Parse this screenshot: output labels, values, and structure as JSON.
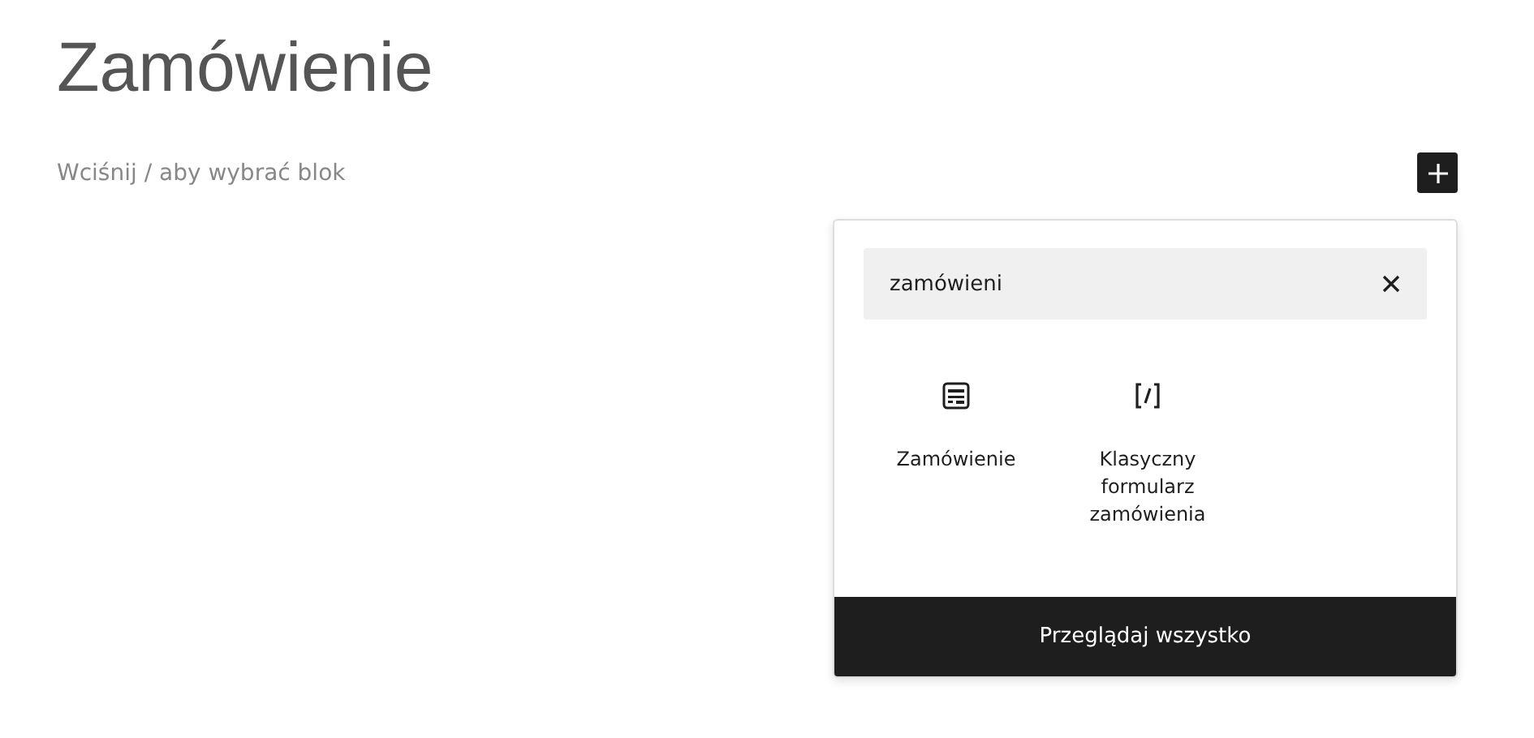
{
  "title": "Zamówienie",
  "block_placeholder": "Wciśnij / aby wybrać blok",
  "inserter": {
    "search": {
      "value": "zamówieni"
    },
    "results": [
      {
        "kind": "form",
        "label": "Zamówienie"
      },
      {
        "kind": "shortcode",
        "label": "Klasyczny formularz zamówienia"
      }
    ],
    "footer_button": "Przeglądaj wszystko"
  }
}
